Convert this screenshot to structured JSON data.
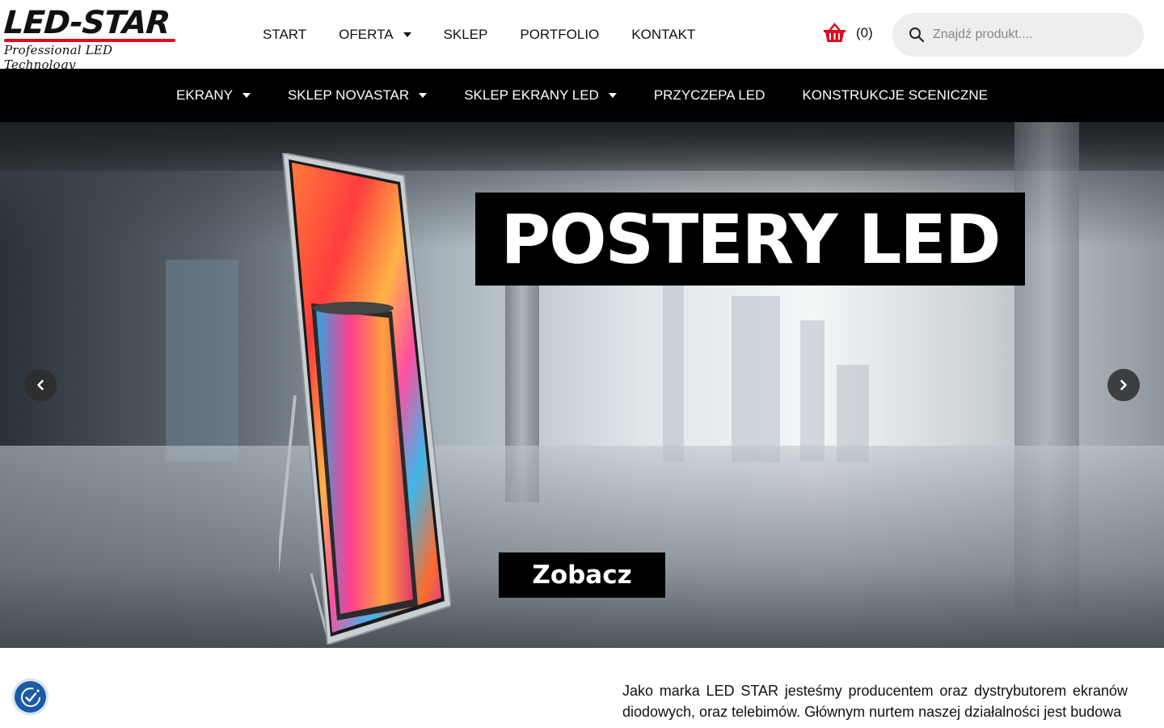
{
  "logo": {
    "title": "LED-STAR",
    "tagline": "Professional LED Technology"
  },
  "top_nav": [
    {
      "label": "START",
      "has_dropdown": false
    },
    {
      "label": "OFERTA",
      "has_dropdown": true
    },
    {
      "label": "SKLEP",
      "has_dropdown": false
    },
    {
      "label": "PORTFOLIO",
      "has_dropdown": false
    },
    {
      "label": "KONTAKT",
      "has_dropdown": false
    }
  ],
  "cart": {
    "count": "(0)",
    "icon": "basket-icon",
    "color": "#e10b1c"
  },
  "search": {
    "placeholder": "Znajdź produkt...."
  },
  "category_nav": [
    {
      "label": "EKRANY",
      "has_dropdown": true
    },
    {
      "label": "SKLEP NOVASTAR",
      "has_dropdown": true
    },
    {
      "label": "SKLEP EKRANY LED",
      "has_dropdown": true
    },
    {
      "label": "PRZYCZEPA LED",
      "has_dropdown": false
    },
    {
      "label": "KONSTRUKCJE SCENICZNE",
      "has_dropdown": false
    }
  ],
  "hero": {
    "headline": "POSTERY LED",
    "cta_label": "Zobacz",
    "prev_icon": "chevron-left-icon",
    "next_icon": "chevron-right-icon"
  },
  "about": {
    "text": "Jako marka LED STAR jesteśmy producentem oraz dystrybutorem ekranów diodowych, oraz telebimów. Głównym nurtem naszej działalności jest budowa"
  },
  "cookie_widget": {
    "icon": "cookie-consent-icon",
    "color": "#1a5aa6"
  },
  "colors": {
    "accent": "#e10b1c",
    "nav_bg": "#000000",
    "search_bg": "#eeeeee"
  }
}
